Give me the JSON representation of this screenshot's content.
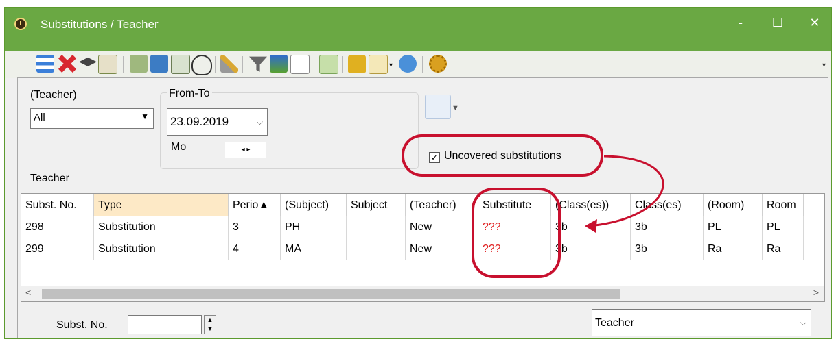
{
  "window": {
    "title": "Substitutions / Teacher",
    "controls": {
      "minimize": "-",
      "maximize": "☐",
      "close": "✕"
    }
  },
  "toolbar": {
    "icons": [
      "list-icon",
      "delete-icon",
      "graduation-cap-icon",
      "import-icon",
      "export-icon",
      "exit-icon",
      "calculator-icon",
      "stethoscope-icon",
      "magic-wand-icon",
      "filter-icon",
      "sort-icon",
      "table-layout-icon",
      "paint-icon",
      "lock-icon",
      "settings-doc-icon",
      "refresh-icon",
      "gear-icon"
    ]
  },
  "filters": {
    "teacher_label": "(Teacher)",
    "teacher_value": "All",
    "fromto_label": "From-To",
    "date": "23.09.2019",
    "weekday": "Mo",
    "uncovered_label": "Uncovered substitutions",
    "uncovered_checked": true
  },
  "section_label": "Teacher",
  "table": {
    "columns": [
      "Subst. No.",
      "Type",
      "Perio▲",
      "(Subject)",
      "Subject",
      "(Teacher)",
      "Substitute",
      "(Class(es))",
      "Class(es)",
      "(Room)",
      "Room"
    ],
    "rows": [
      [
        "298",
        "Substitution",
        "3",
        "PH",
        "",
        "New",
        "???",
        "3b",
        "3b",
        "PL",
        "PL"
      ],
      [
        "299",
        "Substitution",
        "4",
        "MA",
        "",
        "New",
        "???",
        "3b",
        "3b",
        "Ra",
        "Ra"
      ]
    ]
  },
  "footer": {
    "subst_label": "Subst. No.",
    "view_select": "Teacher"
  },
  "colors": {
    "titlebar": "#6aa843",
    "highlight_header": "#fde9c6",
    "annotation": "#c8102e",
    "missing_substitute": "#e02020"
  }
}
